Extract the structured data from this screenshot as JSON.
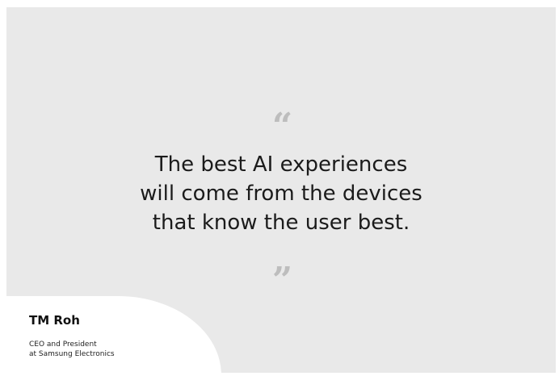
{
  "quote": {
    "open_mark": "“",
    "close_mark": "”",
    "lines": [
      "The best AI experiences",
      "will come from the devices",
      "that know the user best."
    ]
  },
  "speaker": {
    "name": "TM Roh",
    "role_lines": [
      "CEO and President",
      "at Samsung Electronics"
    ]
  },
  "colors": {
    "card_background": "#e9e9e9",
    "quote_mark": "#bdbdbd",
    "text": "#1b1b1b",
    "attribution_panel": "#ffffff"
  }
}
